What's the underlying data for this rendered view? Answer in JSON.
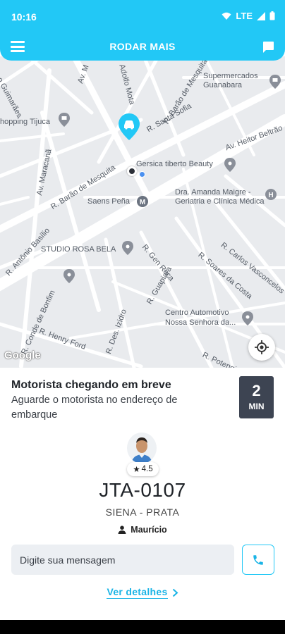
{
  "status_bar": {
    "time": "10:16",
    "network": "LTE"
  },
  "header": {
    "title": "RODAR MAIS"
  },
  "map": {
    "labels": {
      "supermercados": "Supermercados\nGuanabara",
      "shopping": "hopping Tijuca",
      "gersica": "Gersica tiberto Beauty",
      "saens": "Saens Peña",
      "amanda": "Dra. Amanda Maigre -\nGeriatria e Clínica Médica",
      "studio": "STUDIO ROSA BELA",
      "centro": "Centro Automotivo\nNossa Senhora da...",
      "guimaraes": "o Guimarães",
      "maracana": "Av. Maracanã",
      "adolfo": "Adolfo Mota",
      "barao_mesquita_top": "R. Barão de Mesquita",
      "santa_sofia": "R. Santa Sofia",
      "heitor": "Av. Heitor Beltrão",
      "barao_mesquita_left": "R. Barão de Mesquita",
      "antonio_basilio": "R. Antônio Basílio",
      "bonfim": "R. Conde de Bonfim",
      "henry_ford": "R. Henry Ford",
      "desembargador": "R. Des. Izidro",
      "gen_roca": "R. Gen Roca",
      "soares_costa": "R. Soares da Costa",
      "carlos_vasconcelos": "R. Carlos Vasconcelos",
      "guapiara": "R. Guapiara",
      "potengi": "R. Potengi",
      "av_ma": "Av. M"
    },
    "attribution": "Google"
  },
  "ride": {
    "title": "Motorista chegando em breve",
    "subtitle": "Aguarde o motorista no endereço de embarque",
    "eta_value": "2",
    "eta_unit": "MIN",
    "rating": "4.5",
    "plate": "JTA-0107",
    "car": "SIENA - PRATA",
    "driver_name": "Maurício"
  },
  "message": {
    "placeholder": "Digite sua mensagem"
  },
  "details_link": "Ver detalhes",
  "colors": {
    "accent": "#22c8f6",
    "eta_bg": "#3d4452",
    "map_bg": "#e9ebee"
  }
}
